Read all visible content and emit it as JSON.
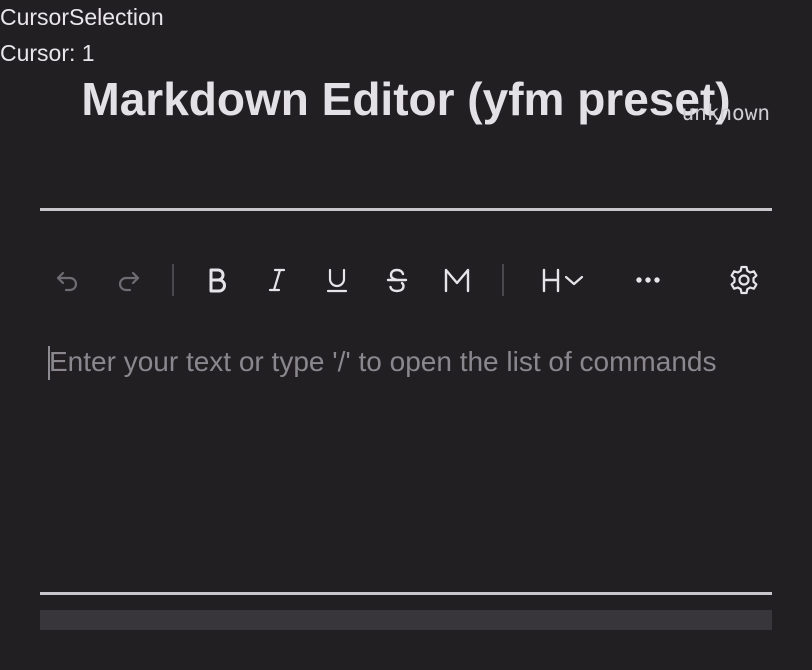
{
  "debug": {
    "title": "CursorSelection",
    "cursor": "Cursor: 1"
  },
  "page": {
    "title": "Markdown Editor (yfm preset)",
    "badge": "unknown"
  },
  "toolbar": {
    "buttons": [
      {
        "name": "undo",
        "icon": "undo-icon",
        "enabled": false
      },
      {
        "name": "redo",
        "icon": "redo-icon",
        "enabled": false
      },
      {
        "name": "bold",
        "icon": "bold-icon",
        "enabled": true
      },
      {
        "name": "italic",
        "icon": "italic-icon",
        "enabled": true
      },
      {
        "name": "underline",
        "icon": "underline-icon",
        "enabled": true
      },
      {
        "name": "strikethrough",
        "icon": "strikethrough-icon",
        "enabled": true
      },
      {
        "name": "mono",
        "icon": "monospace-icon",
        "enabled": true
      },
      {
        "name": "heading",
        "icon": "heading-icon",
        "enabled": true
      },
      {
        "name": "more",
        "icon": "more-horizontal-icon",
        "enabled": true
      },
      {
        "name": "settings",
        "icon": "gear-icon",
        "enabled": true
      }
    ]
  },
  "editor": {
    "placeholder": "Enter your text or type '/' to open the list of commands"
  },
  "colors": {
    "background": "#221f23",
    "text": "#e8e6ea",
    "icon": "#e6e4e8",
    "icon_disabled": "#6e6b72",
    "placeholder": "#8a878e",
    "rule": "#c8c6cb",
    "statusbar": "#38353b"
  }
}
